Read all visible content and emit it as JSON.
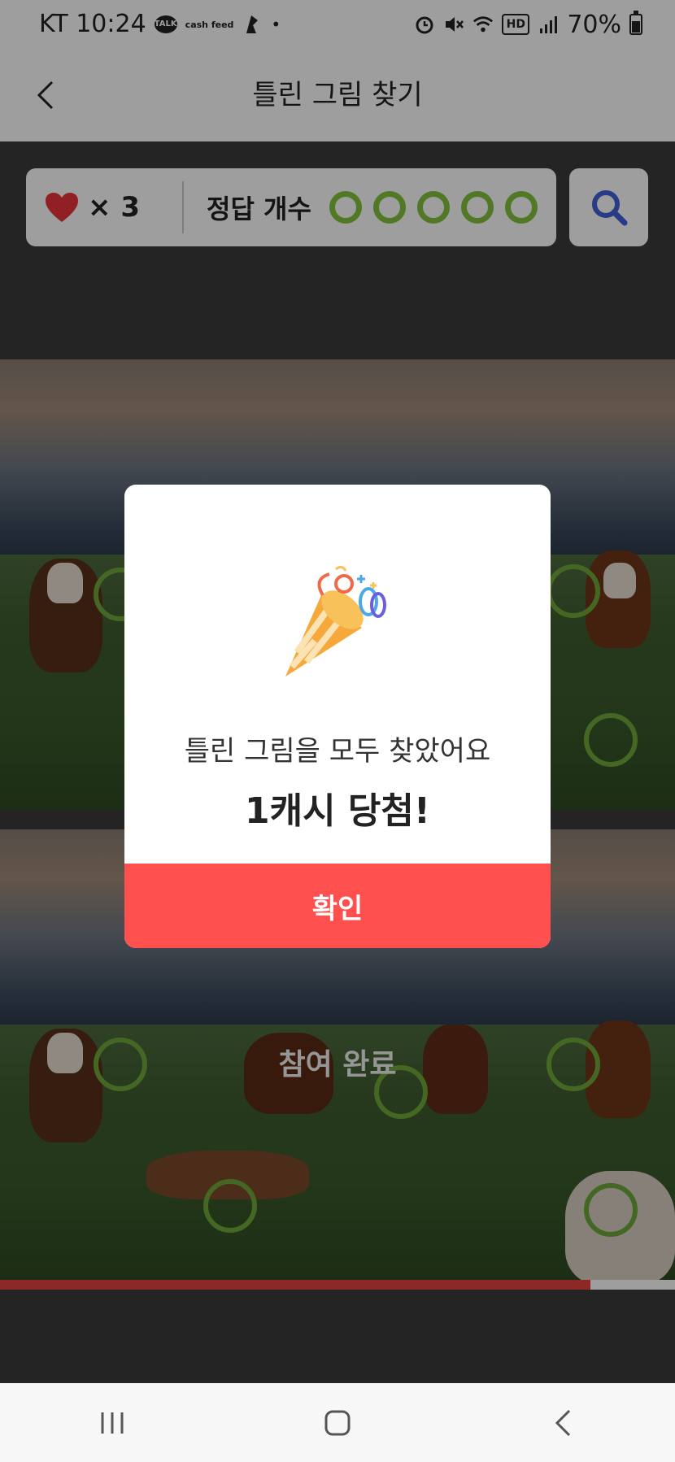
{
  "status_bar": {
    "carrier_time": "KT 10:24",
    "talk_badge": "TALK",
    "cashfeed_badge": "cash feed",
    "battery": "70%"
  },
  "header": {
    "title": "틀린 그림 찾기"
  },
  "game": {
    "lives_count": "× 3",
    "answers_label": "정답 개수",
    "answers_found": 5,
    "answers_total": 5,
    "done_label": "참여 완료",
    "progress": 0.875
  },
  "modal": {
    "message": "틀린 그림을 모두 찾았어요",
    "prize": "1캐시 당첨!",
    "confirm_label": "확인"
  },
  "colors": {
    "accent_red": "#ff5050",
    "answer_green": "#84c23a",
    "heart_red": "#e8353a",
    "hint_blue": "#3f5fd8"
  }
}
